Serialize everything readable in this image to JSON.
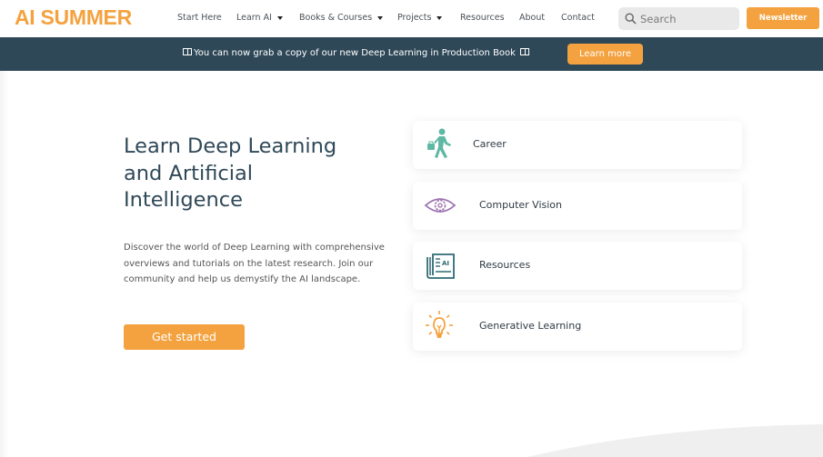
{
  "header": {
    "logo": "AI SUMMER",
    "nav": [
      {
        "label": "Start Here",
        "dropdown": false
      },
      {
        "label": "Learn AI",
        "dropdown": true
      },
      {
        "label": "Books & Courses",
        "dropdown": true
      },
      {
        "label": "Projects",
        "dropdown": true
      },
      {
        "label": "Resources",
        "dropdown": false
      },
      {
        "label": "About",
        "dropdown": false
      },
      {
        "label": "Contact",
        "dropdown": false
      }
    ],
    "search": {
      "placeholder": "Search",
      "value": "",
      "icon": "search-icon"
    },
    "newsletter_label": "Newsletter"
  },
  "banner": {
    "text": "You can now grab a copy of our new Deep Learning in Production Book",
    "button_label": "Learn more"
  },
  "hero": {
    "title": "Learn Deep Learning and Artificial Intelligence",
    "description": "Discover the world of Deep Learning with comprehensive overviews and tutorials on the latest research. Join our community and help us demystify the AI landscape.",
    "cta_label": "Get started"
  },
  "cards": [
    {
      "label": "Career",
      "icon": "walking-person-briefcase-icon"
    },
    {
      "label": "Computer Vision",
      "icon": "eye-gear-icon"
    },
    {
      "label": "Resources",
      "icon": "newspaper-ai-icon"
    },
    {
      "label": "Generative Learning",
      "icon": "lightbulb-icon"
    }
  ],
  "colors": {
    "accent": "#f4a23f",
    "banner_bg": "#2f4858",
    "heading": "#2f4858",
    "career_icon": "#5fb8a3",
    "vision_icon": "#9b72b0",
    "resources_icon": "#2f6b74",
    "generative_icon": "#f4a23f"
  }
}
